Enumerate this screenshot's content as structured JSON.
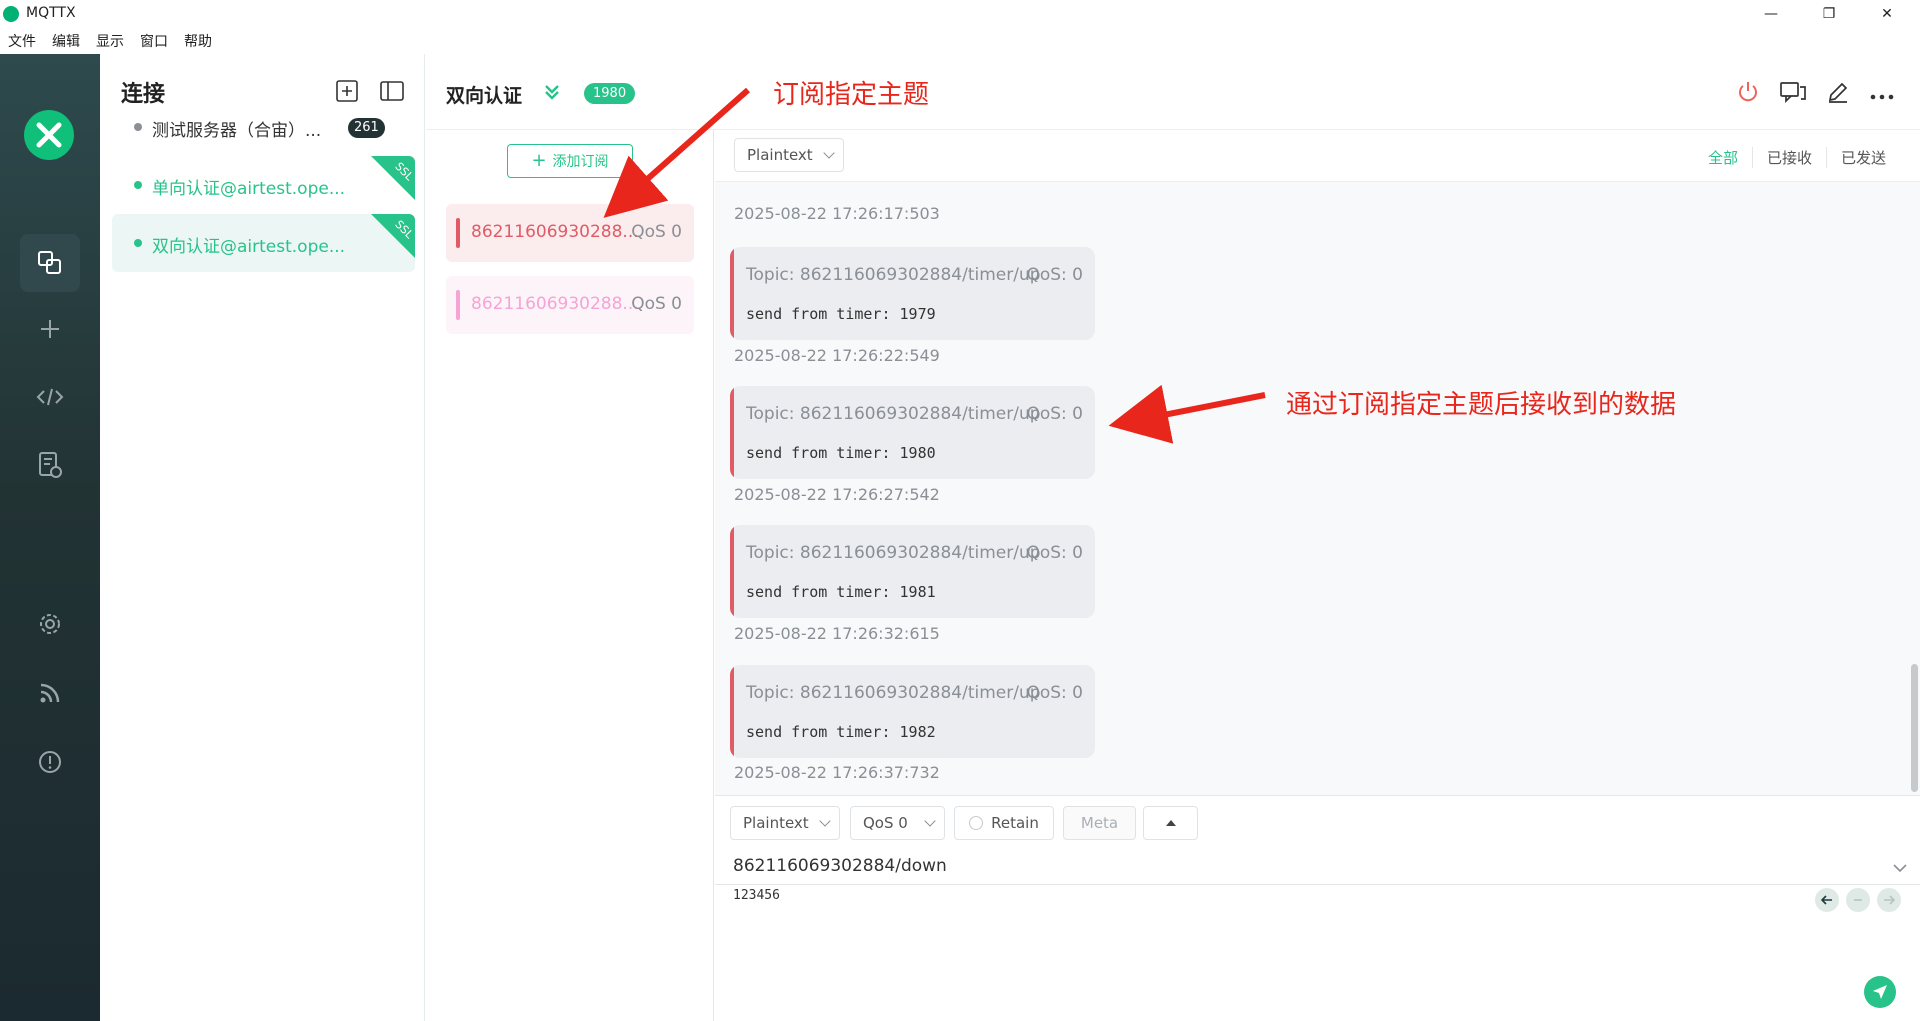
{
  "window": {
    "title": "MQTTX",
    "minimize": "—",
    "maximize": "❐",
    "close": "✕"
  },
  "menu": [
    "文件",
    "编辑",
    "显示",
    "窗口",
    "帮助"
  ],
  "rail": {
    "items": [
      {
        "name": "connections-icon",
        "active": true
      },
      {
        "name": "new-connection-icon"
      },
      {
        "name": "script-icon"
      },
      {
        "name": "log-icon"
      },
      {
        "name": "settings-icon"
      },
      {
        "name": "feed-icon"
      },
      {
        "name": "about-icon"
      }
    ]
  },
  "connections": {
    "title": "连接",
    "items": [
      {
        "name": "测试服务器（合宙）...",
        "badge": "261",
        "dot_color": "#8a8f96",
        "name_color": "#333333",
        "ssl": false,
        "active": false
      },
      {
        "name": "单向认证@airtest.ope...",
        "badge": "",
        "dot_color": "#28c38a",
        "name_color": "#28c38a",
        "ssl": true,
        "ssl_label": "SSL",
        "active": false
      },
      {
        "name": "双向认证@airtest.ope...",
        "badge": "",
        "dot_color": "#28c38a",
        "name_color": "#28c38a",
        "ssl": true,
        "ssl_label": "SSL",
        "active": true
      }
    ]
  },
  "header": {
    "title": "双向认证",
    "count": "1980"
  },
  "subscriptions": {
    "add_label": "添加订阅",
    "items": [
      {
        "topic": "86211606930288...",
        "qos": "QoS 0",
        "color": "#e05b66",
        "bg": "#fbeced"
      },
      {
        "topic": "86211606930288...",
        "qos": "QoS 0",
        "color": "#f6a3d6",
        "bg": "#fcf4f8"
      }
    ]
  },
  "message_toolbar": {
    "format": "Plaintext",
    "filters": [
      "全部",
      "已接收",
      "已发送"
    ]
  },
  "messages": {
    "first_time": "2025-08-22 17:26:17:503",
    "items": [
      {
        "topic": "Topic: 862116069302884/timer/up",
        "qos": "QoS: 0",
        "payload": "send from timer: 1979",
        "time": "2025-08-22 17:26:22:549"
      },
      {
        "topic": "Topic: 862116069302884/timer/up",
        "qos": "QoS: 0",
        "payload": "send from timer: 1980",
        "time": "2025-08-22 17:26:27:542"
      },
      {
        "topic": "Topic: 862116069302884/timer/up",
        "qos": "QoS: 0",
        "payload": "send from timer: 1981",
        "time": "2025-08-22 17:26:32:615"
      },
      {
        "topic": "Topic: 862116069302884/timer/up",
        "qos": "QoS: 0",
        "payload": "send from timer: 1982",
        "time": "2025-08-22 17:26:37:732"
      }
    ]
  },
  "composer": {
    "format": "Plaintext",
    "qos": "QoS 0",
    "retain": "Retain",
    "meta": "Meta",
    "topic": "862116069302884/down",
    "payload": "123456"
  },
  "annotations": {
    "subscribe": "订阅指定主题",
    "received": "通过订阅指定主题后接收到的数据",
    "color": "#e8261b"
  }
}
